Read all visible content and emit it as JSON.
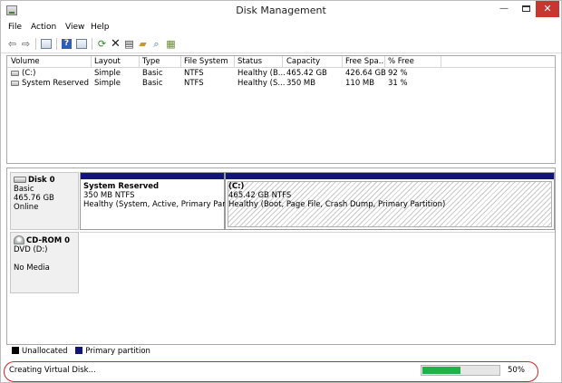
{
  "window": {
    "title": "Disk Management"
  },
  "menu": [
    "File",
    "Action",
    "View",
    "Help"
  ],
  "toolbar_icons": [
    "back-arrow-icon",
    "forward-arrow-icon",
    "console-tree-icon",
    "help-icon",
    "properties-grid-icon",
    "refresh-icon",
    "delete-icon",
    "properties-icon",
    "open-folder-icon",
    "search-icon",
    "export-icon"
  ],
  "volume_list": {
    "columns": [
      "Volume",
      "Layout",
      "Type",
      "File System",
      "Status",
      "Capacity",
      "Free Spa...",
      "% Free"
    ],
    "rows": [
      [
        "(C:)",
        "Simple",
        "Basic",
        "NTFS",
        "Healthy (B...",
        "465.42 GB",
        "426.64 GB",
        "92 %"
      ],
      [
        "System Reserved",
        "Simple",
        "Basic",
        "NTFS",
        "Healthy (S...",
        "350 MB",
        "110 MB",
        "31 %"
      ]
    ]
  },
  "disks": {
    "disk0": {
      "name": "Disk 0",
      "type": "Basic",
      "size": "465.76 GB",
      "state": "Online",
      "partitions": [
        {
          "title": "System Reserved",
          "size": "350 MB NTFS",
          "status": "Healthy (System, Active, Primary Partition"
        },
        {
          "title": "(C:)",
          "size": "465.42 GB NTFS",
          "status": "Healthy (Boot, Page File, Crash Dump, Primary Partition)"
        }
      ]
    },
    "cdrom0": {
      "name": "CD-ROM 0",
      "type": "DVD (D:)",
      "state": "No Media"
    }
  },
  "legend": {
    "unallocated": "Unallocated",
    "primary": "Primary partition",
    "unallocated_color": "#000000",
    "primary_color": "#11157a"
  },
  "status": {
    "text": "Creating Virtual Disk...",
    "progress_percent": 50,
    "progress_label": "50%",
    "progress_color": "#1fb24a"
  }
}
